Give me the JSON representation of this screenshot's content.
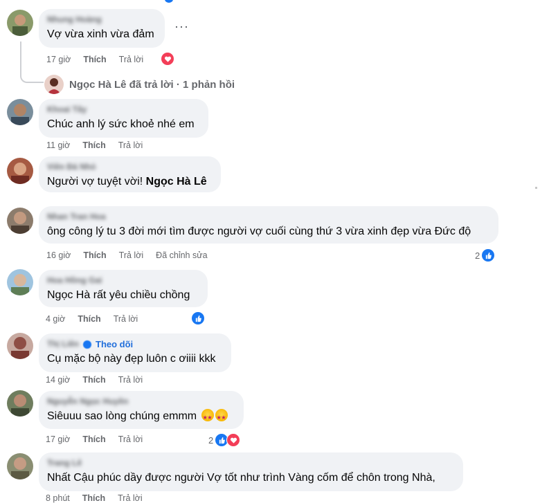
{
  "comments": [
    {
      "author": "Nhung Hoàng",
      "text": "Vợ vừa xinh vừa đảm",
      "time": "17 giờ",
      "like": "Thích",
      "reply": "Trả lời"
    },
    {
      "author": "Khoai Tây",
      "text": "Chúc anh lý sức khoẻ nhé em",
      "time": "11 giờ",
      "like": "Thích",
      "reply": "Trả lời"
    },
    {
      "author": "Viên Đá Nhỏ",
      "text": "Người vợ tuyệt vời!",
      "tag": "Ngọc Hà Lê",
      "time": "",
      "like": "",
      "reply": ""
    },
    {
      "author": "Nhan Tran Hoa",
      "text": "ông công lý tu 3 đời mới tìm được người vợ cuối cùng thứ 3 vừa xinh đẹp vừa Đức độ",
      "time": "16 giờ",
      "like": "Thích",
      "reply": "Trả lời",
      "edited": "Đã chỉnh sửa",
      "reactions": "2"
    },
    {
      "author": "Hoa Hồng Gai",
      "text": "Ngọc Hà rất yêu chiều chồng",
      "time": "4 giờ",
      "like": "Thích",
      "reply": "Trả lời"
    },
    {
      "author": "Thị Liên",
      "follow": "Theo dõi",
      "text": "Cụ mặc bộ này đẹp luôn c ơiiii kkk",
      "time": "14 giờ",
      "like": "Thích",
      "reply": "Trả lời"
    },
    {
      "author": "Nguyễn Ngọc Huyền",
      "text": "Siêuuu sao lòng chúng emmm",
      "time": "17 giờ",
      "like": "Thích",
      "reply": "Trả lời",
      "reactions": "2"
    },
    {
      "author": "Trang Lê",
      "text": "Nhất Cậu phúc dầy được người Vợ tốt như trình Vàng cốm để chôn trong Nhà,",
      "time": "8 phút",
      "like": "Thích",
      "reply": "Trả lời"
    }
  ],
  "reply_summary": "Ngọc Hà Lê đã trả lời · 1 phản hồi",
  "more_options": "···",
  "colors": {
    "like_blue": "#1877f2",
    "love_red": "#f33e58",
    "bubble": "#f0f2f5",
    "follow_blue": "#216fdb"
  }
}
